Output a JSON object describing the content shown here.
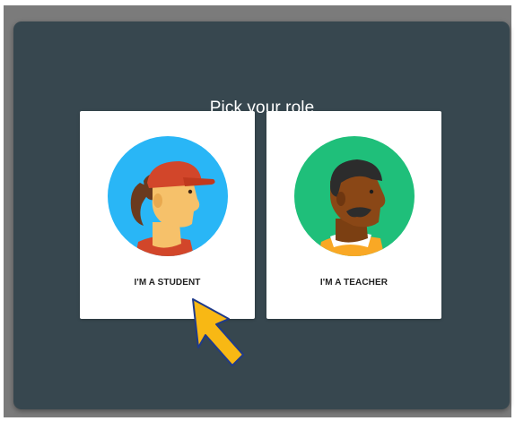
{
  "dialog": {
    "title": "Pick your role"
  },
  "roles": [
    {
      "label": "I'M A STUDENT",
      "avatar_icon": "student-avatar-icon"
    },
    {
      "label": "I'M A TEACHER",
      "avatar_icon": "teacher-avatar-icon"
    }
  ],
  "colors": {
    "dialog_bg": "#37474f",
    "student_circle": "#29b6f6",
    "teacher_circle": "#1fbf7a",
    "cap": "#d2462a",
    "arrow": "#f8b814"
  }
}
